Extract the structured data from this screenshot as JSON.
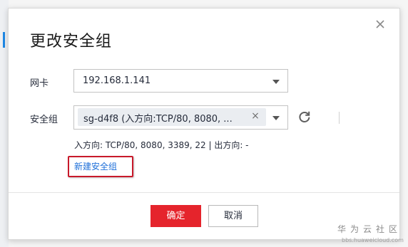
{
  "dialog": {
    "title": "更改安全组"
  },
  "nic": {
    "label": "网卡",
    "selected": "192.168.1.141"
  },
  "security_group": {
    "label": "安全组",
    "selected_tag": "sg-d4f8 (入方向:TCP/80, 8080, ...",
    "remove_symbol": "×",
    "rule_summary": "入方向: TCP/80, 8080, 3389, 22 | 出方向: -",
    "create_link": "新建安全组"
  },
  "footer": {
    "confirm_label": "确定",
    "cancel_label": "取消"
  },
  "watermark": {
    "text": "华为云社区",
    "subtext": "bbs.huaweicloud.com"
  },
  "colors": {
    "primary_button": "#e5242c",
    "link": "#1e6fd9",
    "highlight_border": "#c8192a"
  }
}
